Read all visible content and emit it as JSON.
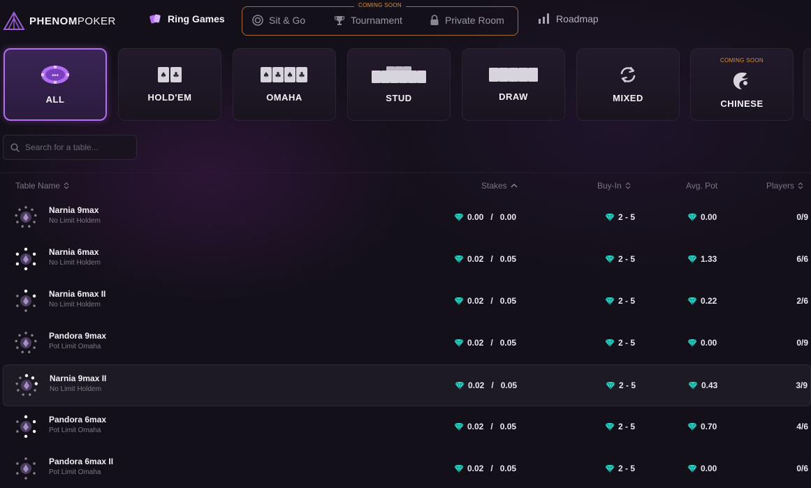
{
  "brand": {
    "name_bold": "PHENOM",
    "name_light": "POKER"
  },
  "nav": {
    "ring_games": "Ring Games",
    "coming_soon": "COMING SOON",
    "sit_go": "Sit & Go",
    "tournament": "Tournament",
    "private_room": "Private Room",
    "roadmap": "Roadmap"
  },
  "categories": [
    {
      "label": "ALL",
      "active": true,
      "icon": "chip-icon"
    },
    {
      "label": "HOLD'EM",
      "icon": "two-cards-icon"
    },
    {
      "label": "OMAHA",
      "icon": "four-cards-icon"
    },
    {
      "label": "STUD",
      "icon": "stud-cards-icon"
    },
    {
      "label": "DRAW",
      "icon": "five-cards-icon"
    },
    {
      "label": "MIXED",
      "icon": "refresh-icon"
    },
    {
      "label": "CHINESE",
      "soon": "COMING SOON",
      "icon": "dragon-icon"
    }
  ],
  "search": {
    "placeholder": "Search for a table..."
  },
  "table": {
    "headers": {
      "name": "Table Name",
      "stakes": "Stakes",
      "buyin": "Buy-In",
      "avg_pot": "Avg. Pot",
      "players": "Players"
    },
    "rows": [
      {
        "name": "Narnia 9max",
        "game": "No Limit Holdem",
        "sb": "0.00",
        "bb": "0.00",
        "buyin": "2 - 5",
        "avg_pot": "0.00",
        "players": "0/9"
      },
      {
        "name": "Narnia 6max",
        "game": "No Limit Holdem",
        "sb": "0.02",
        "bb": "0.05",
        "buyin": "2 - 5",
        "avg_pot": "1.33",
        "players": "6/6"
      },
      {
        "name": "Narnia 6max II",
        "game": "No Limit Holdem",
        "sb": "0.02",
        "bb": "0.05",
        "buyin": "2 - 5",
        "avg_pot": "0.22",
        "players": "2/6"
      },
      {
        "name": "Pandora 9max",
        "game": "Pot Limit Omaha",
        "sb": "0.02",
        "bb": "0.05",
        "buyin": "2 - 5",
        "avg_pot": "0.00",
        "players": "0/9"
      },
      {
        "name": "Narnia 9max II",
        "game": "No Limit Holdem",
        "sb": "0.02",
        "bb": "0.05",
        "buyin": "2 - 5",
        "avg_pot": "0.43",
        "players": "3/9"
      },
      {
        "name": "Pandora 6max",
        "game": "Pot Limit Omaha",
        "sb": "0.02",
        "bb": "0.05",
        "buyin": "2 - 5",
        "avg_pot": "0.70",
        "players": "4/6"
      },
      {
        "name": "Pandora 6max II",
        "game": "Pot Limit Omaha",
        "sb": "0.02",
        "bb": "0.05",
        "buyin": "2 - 5",
        "avg_pot": "0.00",
        "players": "0/6"
      }
    ]
  },
  "colors": {
    "accent": "#b46ef0",
    "soon": "#d98f3a",
    "gem": "#2fd6c8",
    "bg": "#141019"
  }
}
